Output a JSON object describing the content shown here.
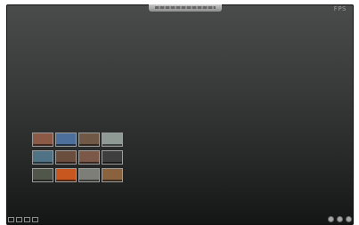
{
  "window": {
    "corner_label": "FPS"
  },
  "thumbnails": [
    {
      "name": "photo-thumb-1",
      "color": "#8a5a46"
    },
    {
      "name": "photo-thumb-2",
      "color": "#4d6f9c"
    },
    {
      "name": "photo-thumb-3",
      "color": "#6f5946"
    },
    {
      "name": "photo-thumb-4",
      "color": "#8f9a94"
    },
    {
      "name": "photo-thumb-5",
      "color": "#4f7284"
    },
    {
      "name": "photo-thumb-6",
      "color": "#6a4d3d"
    },
    {
      "name": "photo-thumb-7",
      "color": "#7b5847"
    },
    {
      "name": "photo-thumb-8",
      "color": "#3e3e3e"
    },
    {
      "name": "photo-thumb-9",
      "color": "#50564a"
    },
    {
      "name": "photo-thumb-10",
      "color": "#c8561f"
    },
    {
      "name": "photo-thumb-11",
      "color": "#7e7e78"
    },
    {
      "name": "photo-thumb-12",
      "color": "#8a633e"
    }
  ],
  "toolbar_left": [
    "grid-view-icon",
    "layout-view-icon",
    "folder-icon",
    "share-icon"
  ],
  "toolbar_right": [
    "shuffle-icon",
    "help-icon",
    "settings-icon"
  ]
}
